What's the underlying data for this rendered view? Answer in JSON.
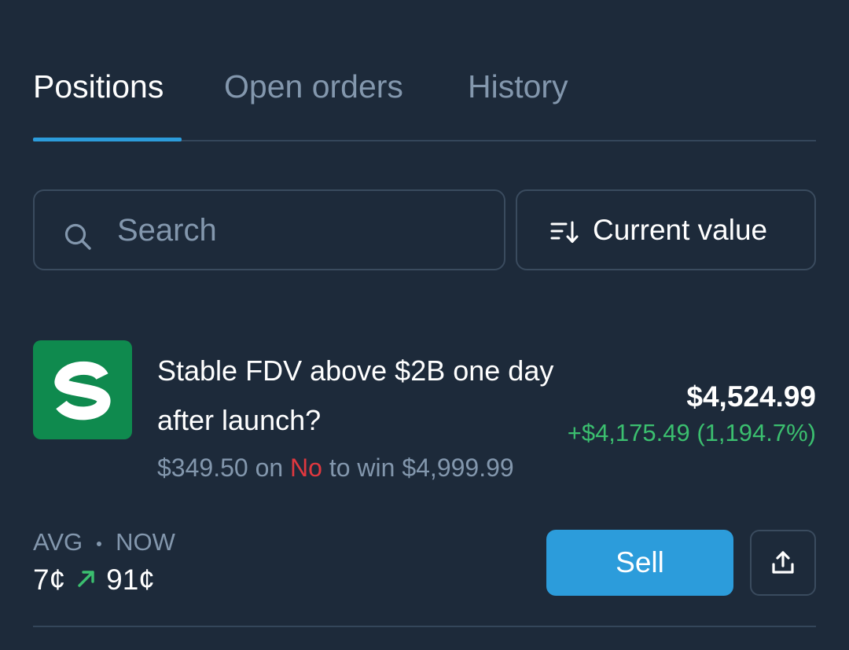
{
  "tabs": [
    {
      "label": "Positions",
      "active": true
    },
    {
      "label": "Open orders",
      "active": false
    },
    {
      "label": "History",
      "active": false
    }
  ],
  "search": {
    "placeholder": "Search",
    "value": ""
  },
  "sort": {
    "label": "Current value",
    "icon": "sort-descending-icon"
  },
  "position": {
    "logo_icon": "stable-logo-icon",
    "title": "Stable FDV above $2B one day after launch?",
    "stake": "$349.50",
    "on_text": "on",
    "side": "No",
    "to_win_text": "to win",
    "payout": "$4,999.99",
    "current_value": "$4,524.99",
    "pnl": "+$4,175.49 (1,194.7%)",
    "avg_label": "AVG",
    "now_label": "NOW",
    "avg_price": "7¢",
    "now_price": "91¢",
    "trend_icon": "arrow-up-right-icon",
    "sell_label": "Sell",
    "share_icon": "share-icon"
  },
  "colors": {
    "background": "#1d2a3a",
    "accent": "#2c9cdb",
    "positive": "#3bbf6f",
    "negative": "#e0383f",
    "muted": "#8397ad",
    "logo_bg": "#0f8a4e"
  }
}
